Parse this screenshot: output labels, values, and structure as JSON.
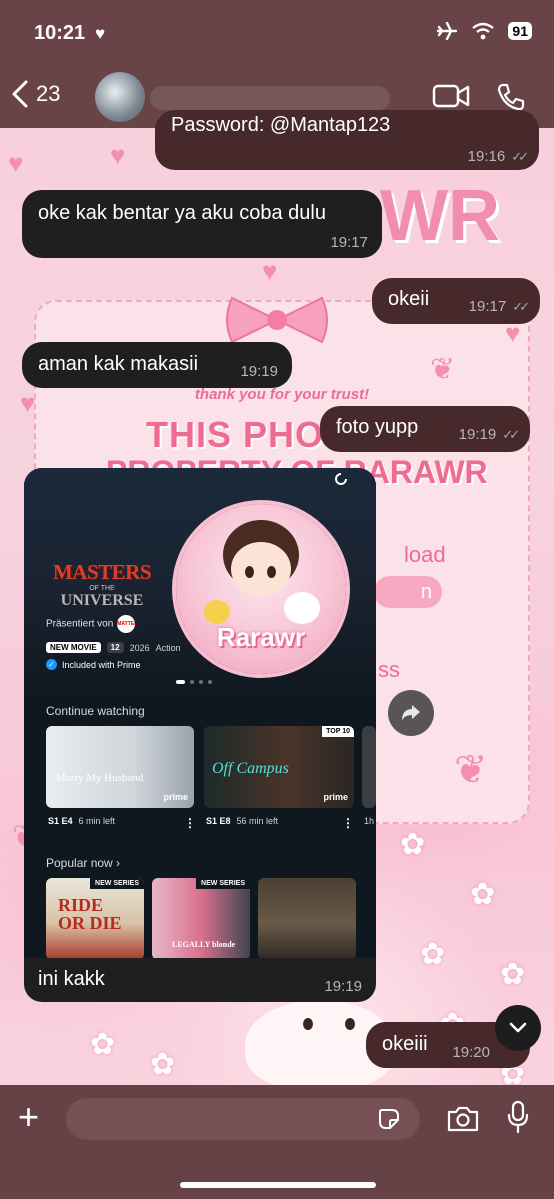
{
  "status_bar": {
    "time": "10:21",
    "battery": "91"
  },
  "header": {
    "back_count": "23"
  },
  "messages": [
    {
      "id": "m0",
      "direction": "out",
      "text": "Password: @Mantap123",
      "time": "19:16",
      "read": true
    },
    {
      "id": "m1",
      "direction": "in",
      "text": "oke kak bentar ya aku coba dulu",
      "time": "19:17"
    },
    {
      "id": "m2",
      "direction": "out",
      "text": "okeii",
      "time": "19:17",
      "read": true
    },
    {
      "id": "m3",
      "direction": "in",
      "text": "aman kak makasii",
      "time": "19:19"
    },
    {
      "id": "m4",
      "direction": "out",
      "text": "foto yupp",
      "time": "19:19",
      "read": true
    },
    {
      "id": "m5",
      "direction": "in",
      "type": "image",
      "caption": "ini kakk",
      "time": "19:19"
    },
    {
      "id": "m6",
      "direction": "out",
      "text": "okeiii",
      "time": "19:20"
    }
  ],
  "shared_screenshot": {
    "hero_title_line1": "MASTERS",
    "hero_title_line2": "OF THE",
    "hero_title_line3": "UNIVERSE",
    "presented_by": "Präsentiert von",
    "presenter_logo": "MATTEL",
    "badge_new": "NEW MOVIE",
    "age_rating": "12",
    "year": "2026",
    "genre": "Action",
    "included": "Included with Prime",
    "avatar_label": "Rarawr",
    "continue_watching_title": "Continue watching",
    "cards": [
      {
        "title": "Marry My Husband",
        "episode": "S1 E4",
        "remaining": "6 min left",
        "badge": "prime"
      },
      {
        "title": "Off Campus",
        "episode": "S1 E8",
        "remaining": "56 min left",
        "badge": "prime",
        "top_badge": "TOP 10"
      },
      {
        "title": "",
        "episode": "1h",
        "remaining": ""
      }
    ],
    "popular_title": "Popular now",
    "popular": [
      {
        "title": "RIDE OR DIE",
        "badge": "NEW SERIES"
      },
      {
        "title": "LEGALLY blonde",
        "badge": "NEW SERIES"
      },
      {
        "title": ""
      }
    ]
  },
  "wallpaper": {
    "thank_you": "thank you for your trust!",
    "big_text_1": "THIS PHOTO",
    "big_text_2": "PROPERTY OF RARAWR",
    "word_load": "load",
    "word_n": "n",
    "word_ss": "ss",
    "big_r": "WR"
  },
  "composer": {
    "placeholder": ""
  },
  "colors": {
    "header_bg": "#603a3e",
    "incoming_bubble": "#1f1f1f",
    "outgoing_bubble": "#47292b",
    "wallpaper_pink": "#f8cdda"
  },
  "icons": [
    "chevron-left-icon",
    "video-call-icon",
    "phone-icon",
    "share-forward-icon",
    "scroll-down-icon",
    "plus-icon",
    "sticker-icon",
    "camera-icon",
    "microphone-icon"
  ]
}
